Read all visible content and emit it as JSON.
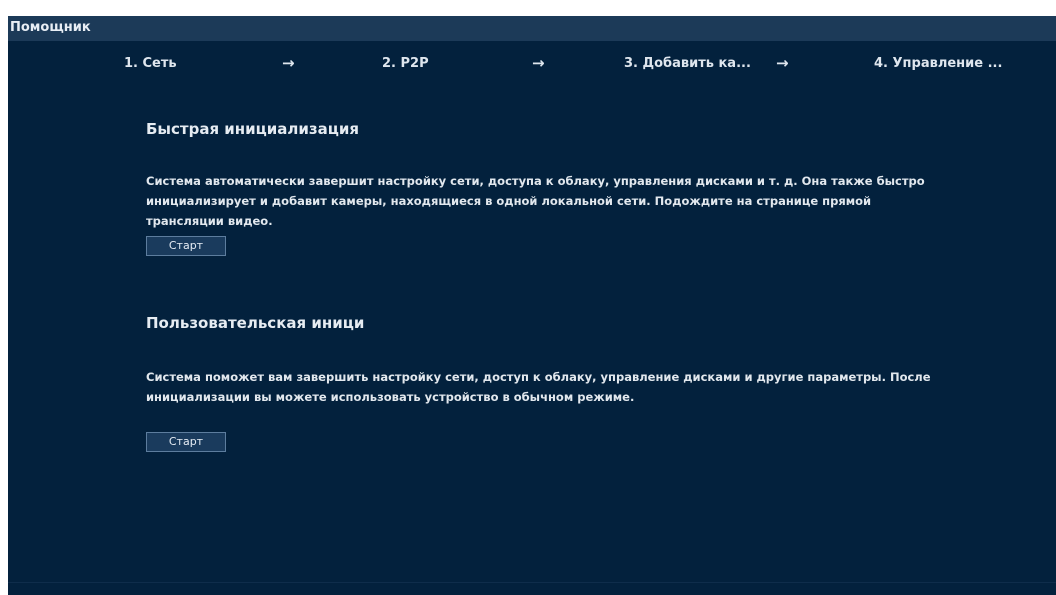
{
  "window": {
    "title": "Помощник"
  },
  "steps": [
    {
      "label": "1.  Сеть"
    },
    {
      "label": "2.  P2P"
    },
    {
      "label": "3.  Добавить ка..."
    },
    {
      "label": "4.  Управление ..."
    }
  ],
  "arrow_glyph": "→",
  "quick_init": {
    "title": "Быстрая инициализация",
    "description": "Система автоматически завершит настройку сети, доступа к облаку, управления дисками и т. д. Она также быстро инициализирует и добавит камеры, находящиеся в одной локальной сети. Подождите на странице прямой трансляции видео.",
    "start_label": "Старт"
  },
  "custom_init": {
    "title": "Пользовательская иници",
    "description": "Система поможет вам завершить настройку сети, доступ к облаку, управление дисками и другие параметры. После инициализации вы можете использовать устройство в обычном режиме.",
    "start_label": "Старт"
  }
}
